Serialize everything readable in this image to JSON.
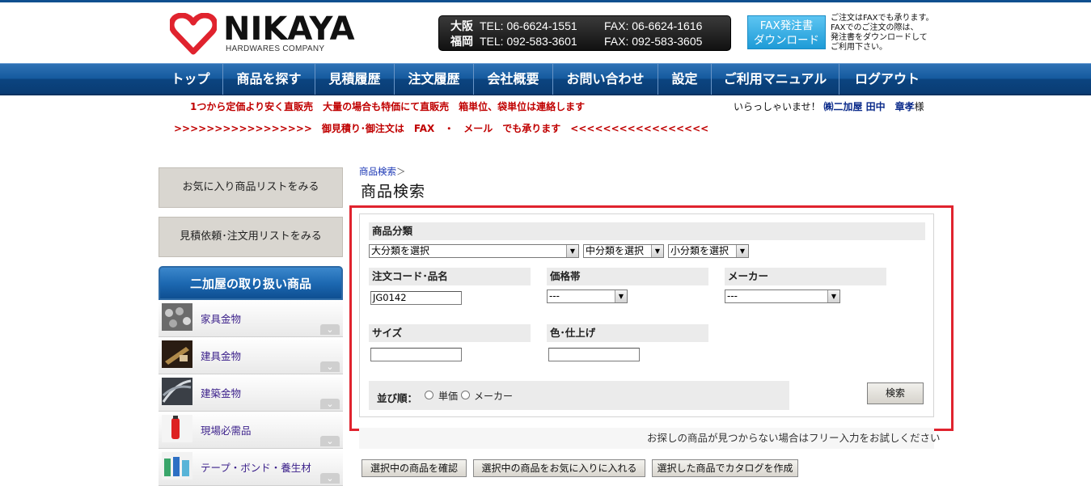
{
  "header": {
    "brand": "NIKAYA",
    "brand_sub": "HARDWARES COMPANY",
    "contacts": [
      {
        "city": "大阪",
        "tel": "TEL: 06-6624-1551",
        "fax": "FAX: 06-6624-1616"
      },
      {
        "city": "福岡",
        "tel": "TEL: 092-583-3601",
        "fax": "FAX: 092-583-3605"
      }
    ],
    "fax_button": {
      "line1": "FAX発注書",
      "line2": "ダウンロード"
    },
    "fax_note": [
      "ご注文はFAXでも承ります。",
      "FAXでのご注文の際は、",
      "発注書をダウンロードして",
      "ご利用下さい。"
    ]
  },
  "nav": [
    "トップ",
    "商品を探す",
    "見積履歴",
    "注文履歴",
    "会社概要",
    "お問い合わせ",
    "設定",
    "ご利用マニュアル",
    "ログアウト"
  ],
  "notices": {
    "line1": "1つから定価より安く直販売　大量の場合も特価にて直販売　箱単位、袋単位は連絡します",
    "line2": ">>>>>>>>>>>>>>>>>　御見積り･御注文は　FAX　・　メール　でも承ります　<<<<<<<<<<<<<<<<<"
  },
  "greeting": {
    "prefix": "いらっしゃいませ！",
    "name": "㈱二加屋 田中　章孝",
    "suffix": "様"
  },
  "sidebar": {
    "favorites_button": "お気に入り商品リストをみる",
    "quote_button": "見積依頼･注文用リストをみる",
    "categories_title": "二加屋の取り扱い商品",
    "categories": [
      {
        "label": "家具金物",
        "icon": "furniture-hardware-icon"
      },
      {
        "label": "建具金物",
        "icon": "fitting-hardware-icon"
      },
      {
        "label": "建築金物",
        "icon": "building-hardware-icon"
      },
      {
        "label": "現場必需品",
        "icon": "site-supplies-icon"
      },
      {
        "label": "テープ・ボンド・養生材",
        "icon": "tape-bond-icon"
      }
    ]
  },
  "main": {
    "breadcrumb": "商品検索",
    "breadcrumb_sep": "＞",
    "title": "商品検索",
    "form": {
      "category_label": "商品分類",
      "major_select": "大分類を選択",
      "middle_select": "中分類を選択",
      "minor_select": "小分類を選択",
      "code_label": "注文コード･品名",
      "code_value": "JG0142",
      "price_label": "価格帯",
      "price_select": "---",
      "maker_label": "メーカー",
      "maker_select": "---",
      "size_label": "サイズ",
      "size_value": "",
      "color_label": "色･仕上げ",
      "color_value": "",
      "sort_label": "並び順：",
      "sort_options": [
        "単価",
        "メーカー"
      ],
      "search_button": "検索"
    },
    "hint": "お探しの商品が見つからない場合はフリー入力をお試しください",
    "actions": [
      "選択中の商品を確認",
      "選択中の商品をお気に入りに入れる",
      "選択した商品でカタログを作成"
    ]
  },
  "colors": {
    "nav": "#155a9e",
    "accent_red": "#e0232e",
    "notice_red": "#c00000",
    "fax_button": "#1e9bd7"
  }
}
